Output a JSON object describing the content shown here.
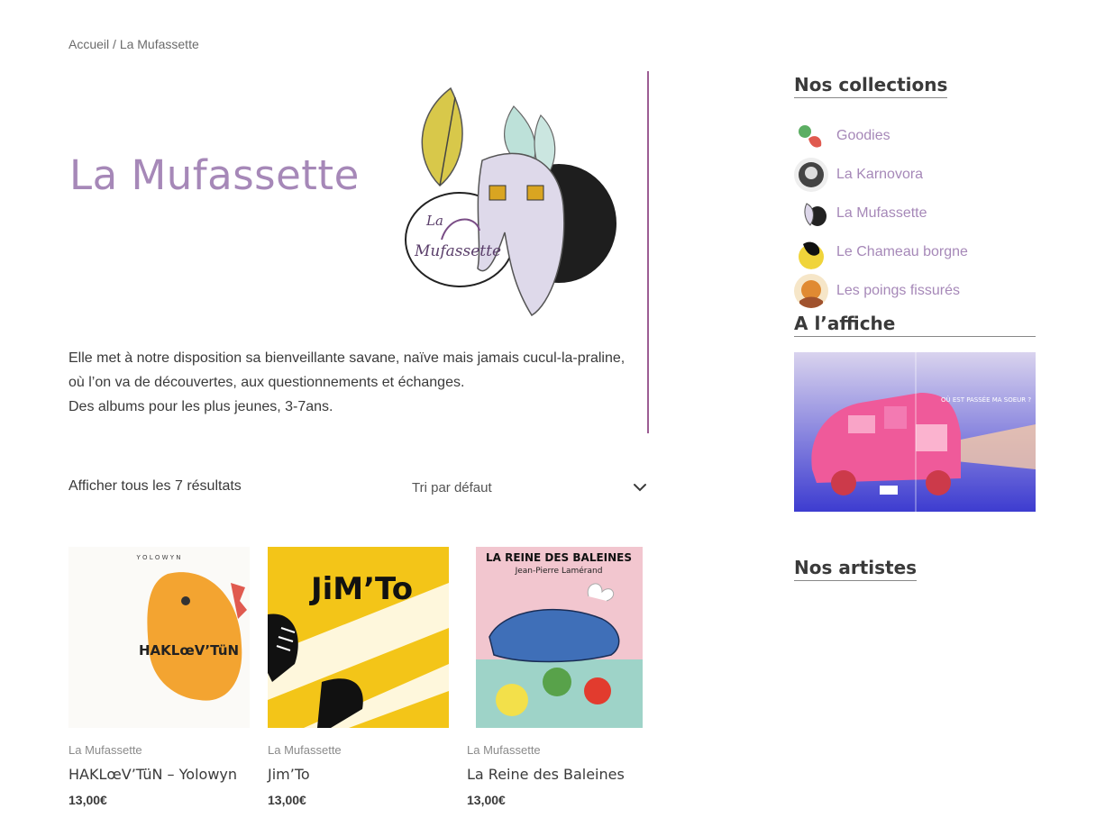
{
  "breadcrumb": {
    "home": "Accueil",
    "separator": " / ",
    "current": "La Mufassette"
  },
  "page": {
    "title": "La Mufassette",
    "logo_text": "La Mufassette",
    "description": [
      "Elle met à notre disposition sa bienveillante savane, naïve mais jamais cucul-la-praline,",
      "où l’on va de découvertes, aux questionnements et échanges.",
      "Des albums pour les plus jeunes, 3-7ans."
    ]
  },
  "shop": {
    "result_count": "Afficher tous les 7 résultats",
    "sort_label": "Tri par défaut"
  },
  "products": [
    {
      "category": "La Mufassette",
      "name": "HAKLœV’TüN – Yolowyn",
      "price": "13,00€",
      "cover_text": "HAKLœV’TüN",
      "top_text": "Y O L O W Y N"
    },
    {
      "category": "La Mufassette",
      "name": "Jim’To",
      "price": "13,00€",
      "cover_text": "JiM’To"
    },
    {
      "category": "La Mufassette",
      "name": "La Reine des Baleines",
      "price": "13,00€",
      "cover_text": "LA REINE DES BALEINES",
      "cover_author": "Jean-Pierre Lamérand"
    }
  ],
  "sidebar": {
    "collections_title": "Nos collections",
    "collections": [
      {
        "label": "Goodies"
      },
      {
        "label": "La Karnovora"
      },
      {
        "label": "La Mufassette"
      },
      {
        "label": "Le Chameau borgne"
      },
      {
        "label": "Les poings fissurés"
      }
    ],
    "poster_title": "A l’affiche",
    "poster_caption": "OÙ EST PASSÉE MA SOEUR ?",
    "artists_title": "Nos artistes"
  },
  "colors": {
    "accent": "#a688b8",
    "divider": "#9c5d93",
    "text": "#3a3a3a"
  }
}
